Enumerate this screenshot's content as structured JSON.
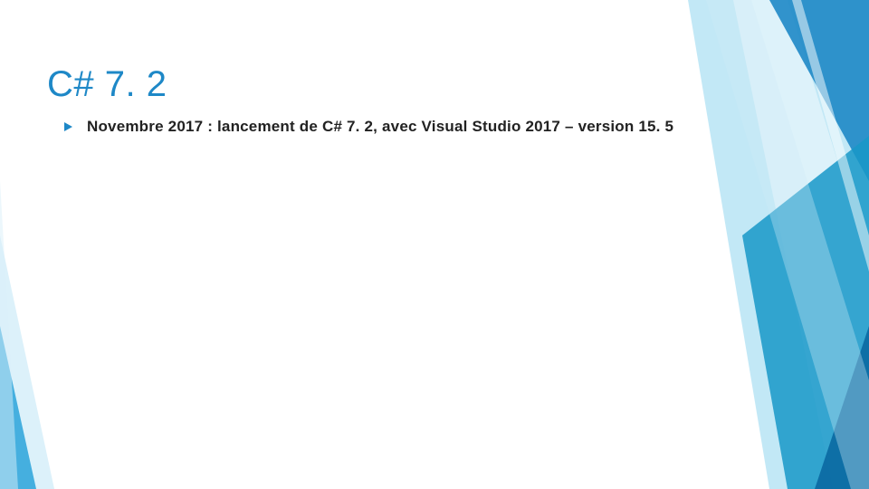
{
  "slide": {
    "title": "C# 7. 2",
    "bullets": [
      {
        "text": "Novembre 2017 : lancement de C# 7. 2, avec Visual Studio 2017 –  version 15. 5"
      }
    ]
  },
  "theme": {
    "accent": "#1e88c7",
    "accent_light": "#6ec5e8",
    "accent_dark": "#0d6ba3"
  }
}
